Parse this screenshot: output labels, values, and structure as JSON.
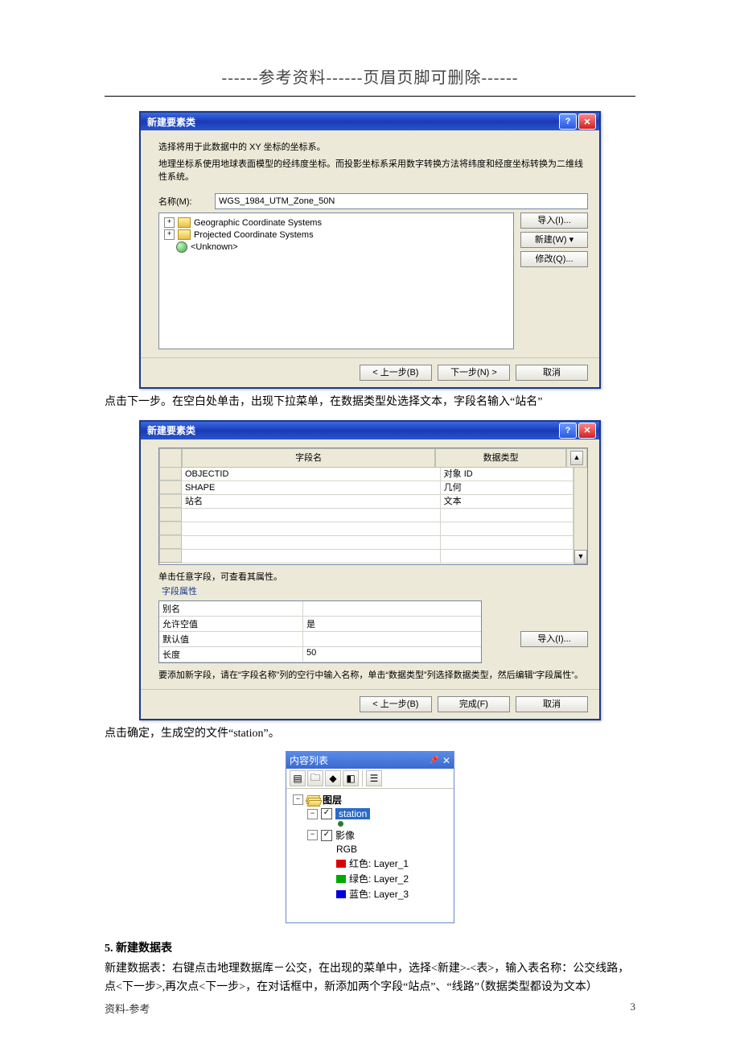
{
  "header": "------参考资料------页眉页脚可删除------",
  "dialog1": {
    "title": "新建要素类",
    "desc1": "选择将用于此数据中的 XY 坐标的坐标系。",
    "desc2": "地理坐标系使用地球表面模型的经纬度坐标。而投影坐标系采用数字转换方法将纬度和经度坐标转换为二维线性系统。",
    "name_label": "名称(M):",
    "name_value": "WGS_1984_UTM_Zone_50N",
    "tree": {
      "geo": "Geographic Coordinate Systems",
      "proj": "Projected Coordinate Systems",
      "unknown": "<Unknown>"
    },
    "btn_import": "导入(I)...",
    "btn_new": "新建(W) ▾",
    "btn_modify": "修改(Q)...",
    "prev": "< 上一步(B)",
    "next": "下一步(N) >",
    "cancel": "取消"
  },
  "para1": "点击下一步。在空白处单击，出现下拉菜单，在数据类型处选择文本，字段名输入“站名”",
  "dialog2": {
    "title": "新建要素类",
    "head_field": "字段名",
    "head_type": "数据类型",
    "rows": [
      {
        "name": "OBJECTID",
        "type": "对象 ID"
      },
      {
        "name": "SHAPE",
        "type": "几何"
      },
      {
        "name": "站名",
        "type": "文本"
      }
    ],
    "hint1": "单击任意字段，可查看其属性。",
    "grp_title": "字段属性",
    "props": {
      "alias_l": "别名",
      "alias_v": "",
      "null_l": "允许空值",
      "null_v": "是",
      "default_l": "默认值",
      "default_v": "",
      "length_l": "长度",
      "length_v": "50"
    },
    "btn_import": "导入(I)...",
    "hint2": "要添加新字段，请在“字段名称”列的空行中输入名称，单击“数据类型”列选择数据类型，然后编辑“字段属性”。",
    "prev": "< 上一步(B)",
    "finish": "完成(F)",
    "cancel": "取消"
  },
  "para2": "点击确定，生成空的文件“station”。",
  "toc": {
    "title": "内容列表",
    "layers_label": "图层",
    "station": "station",
    "image": "影像",
    "rgb": "RGB",
    "red_l": "红色:",
    "red_v": "Layer_1",
    "green_l": "绿色:",
    "green_v": "Layer_2",
    "blue_l": "蓝色:",
    "blue_v": "Layer_3"
  },
  "section5": {
    "heading": "5.   新建数据表",
    "body": "新建数据表：右键点击地理数据库－公交，在出现的菜单中，选择<新建>-<表>，输入表名称：公交线路，点<下一步>,再次点<下一步>，在对话框中，新添加两个字段“站点”、“线路”（数据类型都设为文本）"
  },
  "footer_left": "资料-参考",
  "footer_right": "3"
}
